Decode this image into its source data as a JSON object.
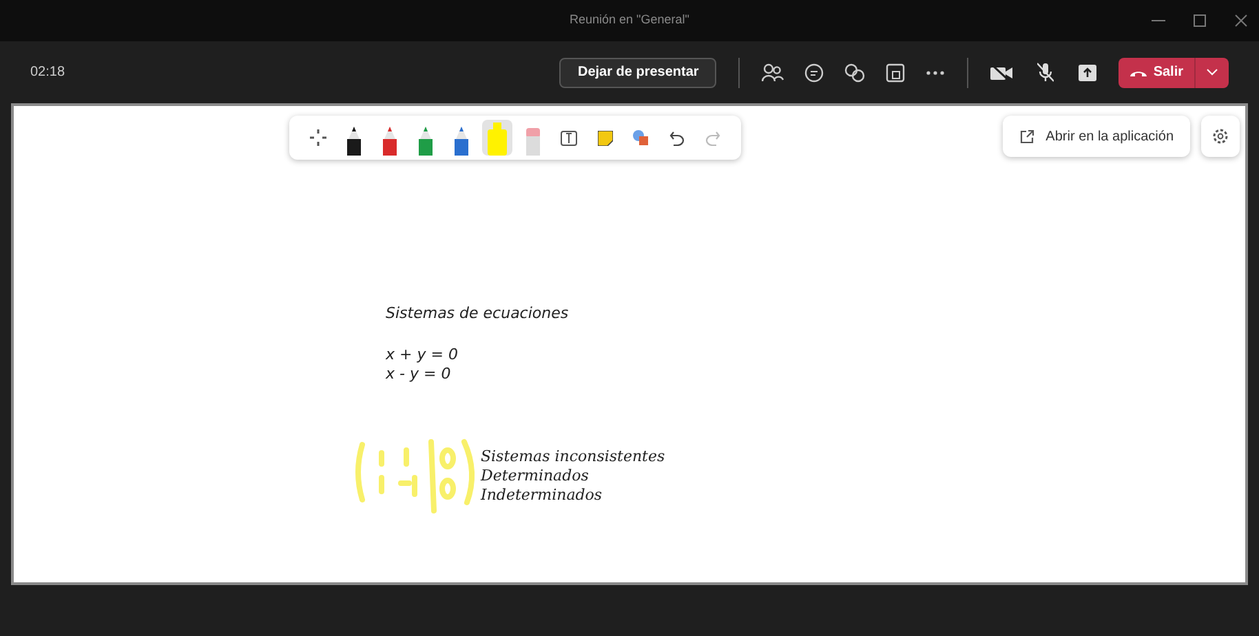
{
  "window": {
    "title": "Reunión en \"General\""
  },
  "meeting_bar": {
    "timer": "02:18",
    "stop_presenting": "Dejar de presentar",
    "leave": "Salir"
  },
  "whiteboard_tools": [
    {
      "kind": "move",
      "selected": false
    },
    {
      "kind": "pen",
      "color": "#1a1a1a",
      "selected": false
    },
    {
      "kind": "pen",
      "color": "#d92b2b",
      "selected": false
    },
    {
      "kind": "pen",
      "color": "#1f9d47",
      "selected": false
    },
    {
      "kind": "pen",
      "color": "#2a6fcf",
      "selected": false
    },
    {
      "kind": "highlighter",
      "color": "#fff200",
      "selected": true
    },
    {
      "kind": "eraser",
      "color": "#f0a0a8",
      "selected": false
    },
    {
      "kind": "text",
      "selected": false
    },
    {
      "kind": "note",
      "selected": false
    },
    {
      "kind": "shapes",
      "selected": false
    },
    {
      "kind": "undo",
      "selected": false
    },
    {
      "kind": "redo",
      "selected": false
    }
  ],
  "open_in_app": "Abrir en la aplicación",
  "board": {
    "title": "Sistemas de ecuaciones",
    "equations": [
      "x + y = 0",
      "x - y = 0"
    ],
    "notes": [
      "Sistemas inconsistentes",
      "Determinados",
      "Indeterminados"
    ]
  }
}
